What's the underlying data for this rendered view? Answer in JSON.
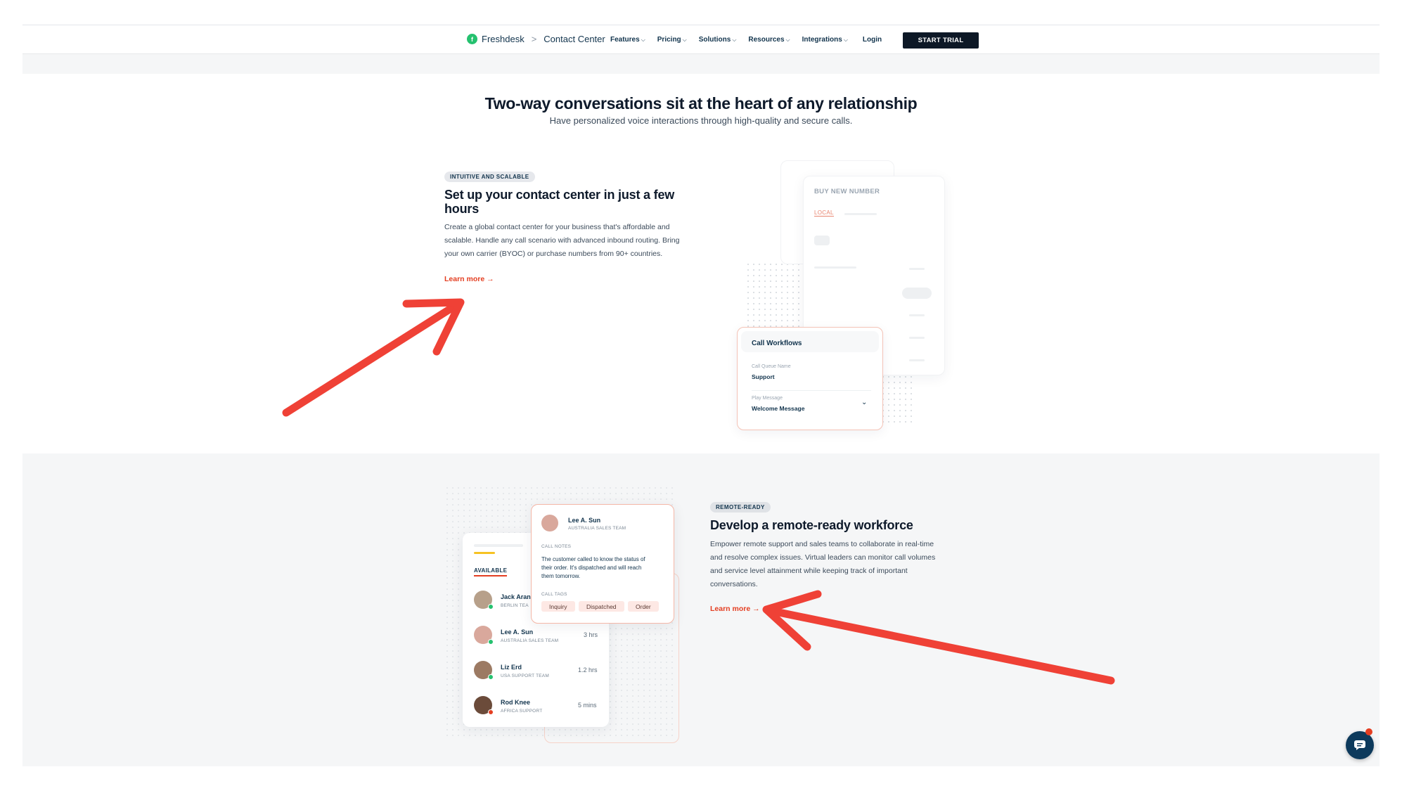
{
  "nav": {
    "brand": "Freshdesk",
    "separator": ">",
    "product": "Contact Center",
    "menu": [
      {
        "label": "Features"
      },
      {
        "label": "Pricing"
      },
      {
        "label": "Solutions"
      },
      {
        "label": "Resources"
      },
      {
        "label": "Integrations"
      }
    ],
    "login": "Login",
    "cta": "START TRIAL"
  },
  "hero": {
    "title": "Two-way conversations sit at the heart of any relationship",
    "subtitle": "Have personalized voice interactions through high-quality and secure calls."
  },
  "feature1": {
    "badge": "INTUITIVE AND SCALABLE",
    "title_line1": "Set up your contact center in just a few",
    "title_line2": "hours",
    "body_line1": "Create a global contact center for your business that's affordable and",
    "body_line2": "scalable. Handle any call scenario with advanced inbound routing. Bring",
    "body_line3": "your own carrier (BYOC) or purchase numbers from 90+ countries.",
    "link": "Learn more →",
    "mock": {
      "buy_title": "BUY NEW NUMBER",
      "buy_tab": "LOCAL",
      "workflow_title": "Call Workflows",
      "queue_label": "Call Queue Name",
      "queue_value": "Support",
      "play_label": "Play Message",
      "play_value": "Welcome Message"
    }
  },
  "feature2": {
    "badge": "REMOTE-READY",
    "title": "Develop a remote-ready workforce",
    "body_line1": "Empower remote support and sales teams to collaborate in real-time",
    "body_line2": "and resolve complex issues. Virtual leaders can monitor call volumes",
    "body_line3": "and service level attainment while keeping track of important",
    "body_line4": "conversations.",
    "link": "Learn more →",
    "mock": {
      "available": "AVAILABLE",
      "agents": [
        {
          "name": "Jack Aran",
          "team": "BERLIN TEA",
          "time": ""
        },
        {
          "name": "Lee A. Sun",
          "team": "AUSTRALIA SALES TEAM",
          "time": "3 hrs"
        },
        {
          "name": "Liz Erd",
          "team": "USA SUPPORT TEAM",
          "time": "1.2 hrs"
        },
        {
          "name": "Rod Knee",
          "team": "AFRICA SUPPORT",
          "time": "5 mins"
        }
      ],
      "note_name": "Lee A. Sun",
      "note_team": "AUSTRALIA SALES TEAM",
      "notes_label": "CALL NOTES",
      "notes_line1": "The customer called to know the status of",
      "notes_line2": "their order. It's dispatched and will reach",
      "notes_line3": "them tomorrow.",
      "tags_label": "CALL TAGS",
      "tags": [
        "Inquiry",
        "Dispatched",
        "Order"
      ]
    }
  },
  "colors": {
    "accent": "#e43e21",
    "dark": "#0d1826",
    "brand_green": "#25c16f",
    "annotation_arrow": "#ef4136"
  },
  "icons": {
    "chat": "chat-bubble-icon",
    "chevron": "chevron-down-icon"
  }
}
